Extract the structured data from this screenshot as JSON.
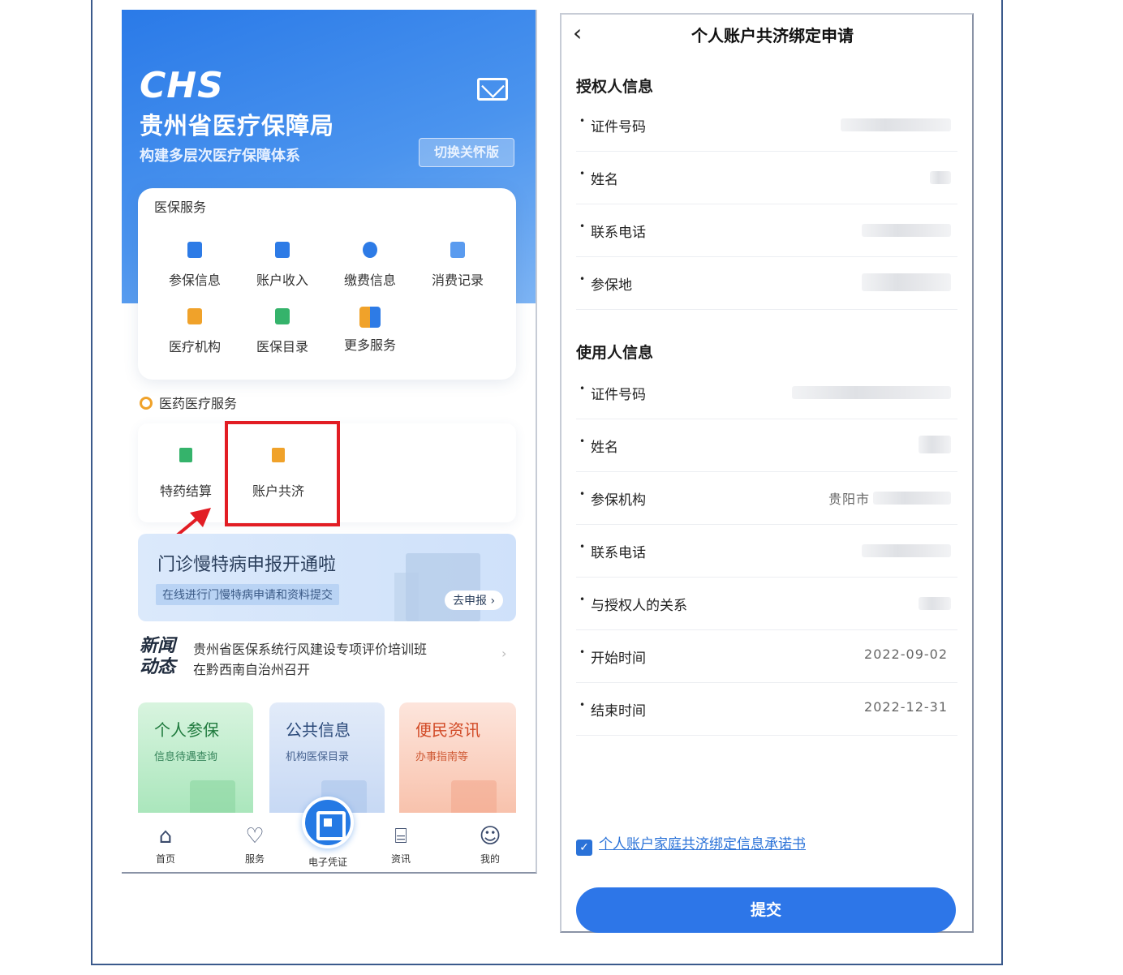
{
  "left": {
    "logo": "CHS",
    "org_name": "贵州省医疗保障局",
    "slogan": "构建多层次医疗保障体系",
    "care_mode_button": "切换关怀版",
    "services": {
      "title": "医保服务",
      "items": [
        {
          "label": "参保信息",
          "icon": "id-card-icon",
          "color": "#2d7be6"
        },
        {
          "label": "账户收入",
          "icon": "wallet-icon",
          "color": "#2d7be6"
        },
        {
          "label": "缴费信息",
          "icon": "money-bag-icon",
          "color": "#2d7be6"
        },
        {
          "label": "消费记录",
          "icon": "receipt-icon",
          "color": "#2d7be6"
        },
        {
          "label": "医疗机构",
          "icon": "institution-icon",
          "color": "#f0a22a"
        },
        {
          "label": "医保目录",
          "icon": "catalog-icon",
          "color": "#35b36b"
        },
        {
          "label": "更多服务",
          "icon": "more-grid-icon",
          "color": "#2d7be6"
        }
      ]
    },
    "medical": {
      "title": "医药医疗服务",
      "items": [
        {
          "label": "特药结算",
          "icon": "medicine-icon",
          "color": "#35b36b"
        },
        {
          "label": "账户共济",
          "icon": "share-people-icon",
          "color": "#f0a22a"
        }
      ]
    },
    "banner": {
      "title": "门诊慢特病申报开通啦",
      "subtitle": "在线进行门慢特病申请和资料提交",
      "button": "去申报"
    },
    "news": {
      "logo_line1": "新闻",
      "logo_line2": "动态",
      "line1": "贵州省医保系统行风建设专项评价培训班",
      "line2": "在黔西南自治州召开"
    },
    "tiles": [
      {
        "title": "个人参保",
        "sub": "信息待遇查询"
      },
      {
        "title": "公共信息",
        "sub": "机构医保目录"
      },
      {
        "title": "便民资讯",
        "sub": "办事指南等"
      }
    ],
    "tabbar": [
      {
        "label": "首页",
        "icon": "home-icon"
      },
      {
        "label": "服务",
        "icon": "heart-icon"
      },
      {
        "label": "电子凭证",
        "icon": "qr-code-icon"
      },
      {
        "label": "资讯",
        "icon": "bookmark-icon"
      },
      {
        "label": "我的",
        "icon": "user-icon"
      }
    ]
  },
  "right": {
    "title": "个人账户共济绑定申请",
    "grantor_section": "授权人信息",
    "grantor_fields": [
      {
        "label": "证件号码"
      },
      {
        "label": "姓名"
      },
      {
        "label": "联系电话"
      },
      {
        "label": "参保地"
      }
    ],
    "user_section": "使用人信息",
    "user_fields": [
      {
        "label": "证件号码"
      },
      {
        "label": "姓名"
      },
      {
        "label": "参保机构",
        "value": "贵阳市"
      },
      {
        "label": "联系电话"
      },
      {
        "label": "与授权人的关系"
      },
      {
        "label": "开始时间",
        "value": "2022-09-02"
      },
      {
        "label": "结束时间",
        "value": "2022-12-31"
      }
    ],
    "agreement": "个人账户家庭共济绑定信息承诺书",
    "agreement_checked": true,
    "submit": "提交"
  }
}
